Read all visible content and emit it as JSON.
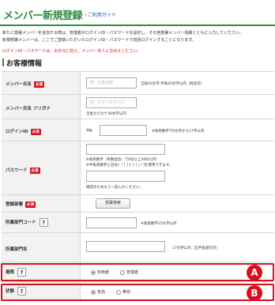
{
  "header": {
    "title": "メンバー新規登録",
    "guide_link": "ご利用ガイド"
  },
  "intro": {
    "line1": "新たに部署メンバーを追加する際は、管理者がログインID・パスワードを設定し、その他部署メンバー情報とともに入力してください。",
    "line2": "新規部署メンバーは、ここでご登録いただいたログインID・パスワードで初回ログインすることになります。"
  },
  "warning": "ログインID・パスワードは、お手元に控え、メンバー本人にお伝えください。",
  "section_title": "お客様情報",
  "required_badge": "必須",
  "form": {
    "member_name": {
      "label": "メンバー氏名",
      "placeholder": "例）大塚太郎",
      "note": "全角10文字,半角20文字以内（姓名可）"
    },
    "member_kana": {
      "label": "メンバー氏名 フリガナ",
      "placeholder": "例）オオツカタロウ",
      "note": "全角カタカナ30文字以内"
    },
    "login_id": {
      "label": "ログインID",
      "prefix": "TM-",
      "note": "※角英数字で9文字から17字以内"
    },
    "password": {
      "label": "パスワード",
      "note1": "※角英数字（英数混合）で6桁以上30桁以内",
      "note2": "※半角英数字と記号[- ! [ ] { } ( ) / ]を使用できます。",
      "note3": "確認のためもう一度入力ください。"
    },
    "department": {
      "label": "登録部署",
      "button": "部署検索"
    },
    "dept_code": {
      "label": "所属部門コード",
      "note": "※角英数字15文字以内"
    },
    "dept_name": {
      "label": "所属部門名",
      "note": "17文字以内（全半角混在可）"
    },
    "authority": {
      "label": "権限",
      "options": [
        "利用者",
        "管理者"
      ],
      "selected": "利用者"
    },
    "status": {
      "label": "状態",
      "options": [
        "有効",
        "無効"
      ],
      "selected": "有効"
    }
  },
  "markers": [
    "A",
    "B"
  ],
  "colors": {
    "brand_green": "#2e8b3a",
    "alert_red": "#d8101c",
    "link_blue": "#1a55a8"
  }
}
